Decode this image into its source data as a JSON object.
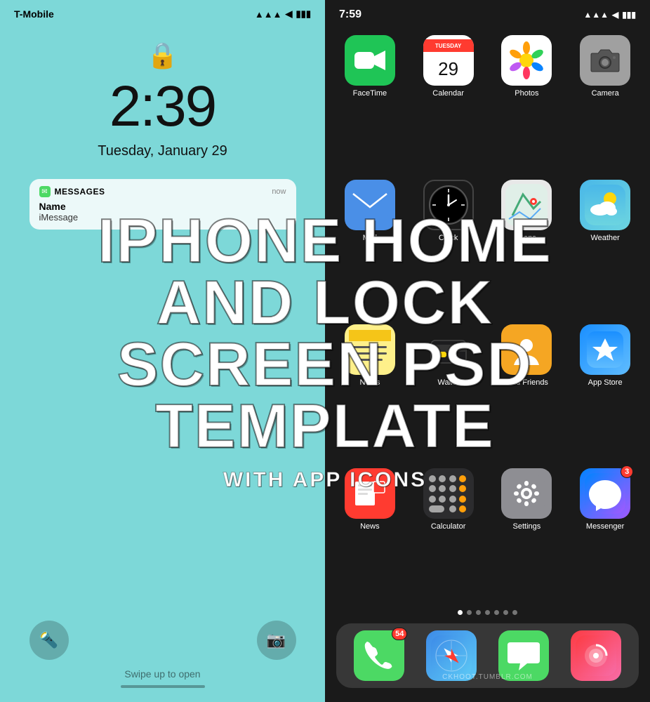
{
  "lock_screen": {
    "carrier": "T-Mobile",
    "time": "2:39",
    "date": "Tuesday, January 29",
    "status_icons": "▲▲▲ ◀ ▮▮▮",
    "notification": {
      "app": "Messages",
      "timestamp": "now",
      "sender": "Name",
      "message": "iMessage"
    },
    "swipe_label": "Swipe up to open"
  },
  "home_screen": {
    "time": "7:59",
    "apps": [
      {
        "id": "facetime",
        "label": "FaceTime",
        "badge": null
      },
      {
        "id": "calendar",
        "label": "Calendar",
        "badge": null
      },
      {
        "id": "photos",
        "label": "Photos",
        "badge": null
      },
      {
        "id": "camera",
        "label": "Camera",
        "badge": null
      },
      {
        "id": "mail",
        "label": "Mail",
        "badge": null
      },
      {
        "id": "clock",
        "label": "Clock",
        "badge": null
      },
      {
        "id": "maps",
        "label": "Maps",
        "badge": null
      },
      {
        "id": "weather",
        "label": "Weather",
        "badge": null
      },
      {
        "id": "notes",
        "label": "Notes",
        "badge": null
      },
      {
        "id": "wallet",
        "label": "Wallet",
        "badge": null
      },
      {
        "id": "find-friends",
        "label": "Find Friends",
        "badge": null
      },
      {
        "id": "app-store",
        "label": "App Store",
        "badge": null
      },
      {
        "id": "news",
        "label": "News",
        "badge": null
      },
      {
        "id": "calculator",
        "label": "Calculator",
        "badge": null
      },
      {
        "id": "settings",
        "label": "Settings",
        "badge": null
      },
      {
        "id": "messenger",
        "label": "Messenger",
        "badge": "3"
      }
    ],
    "dock": [
      {
        "id": "phone",
        "label": "Phone",
        "badge": "54"
      },
      {
        "id": "safari",
        "label": "Safari",
        "badge": null
      },
      {
        "id": "messages",
        "label": "Messages",
        "badge": null
      },
      {
        "id": "music",
        "label": "Music",
        "badge": null
      }
    ],
    "watermark": "CKHOOT.TUMBLR.COM"
  },
  "overlay": {
    "title_line1": "IPHONE HOME",
    "title_line2": "AND LOCK",
    "title_line3": "SCREEN PSD",
    "title_line4": "TEMPLATE",
    "subtitle": "WITH APP ICONS"
  }
}
